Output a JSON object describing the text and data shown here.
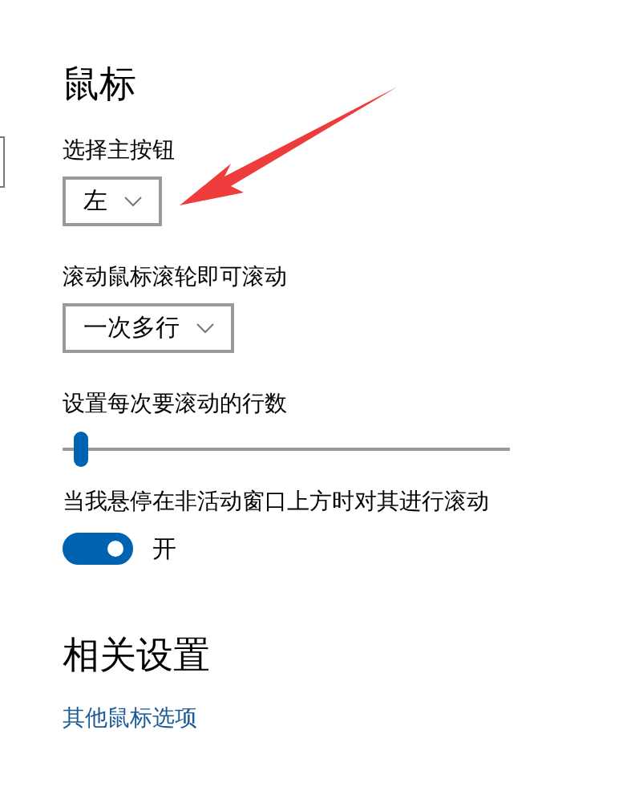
{
  "title": "鼠标",
  "settings": [
    {
      "kind": "dropdown",
      "label": "选择主按钮",
      "value": "左"
    },
    {
      "kind": "dropdown",
      "label": "滚动鼠标滚轮即可滚动",
      "value": "一次多行"
    },
    {
      "kind": "slider",
      "label": "设置每次要滚动的行数",
      "level": 0.02
    },
    {
      "kind": "toggle",
      "label": "当我悬停在非活动窗口上方时对其进行滚动",
      "on": true,
      "state_text": "开"
    }
  ],
  "related": {
    "title": "相关设置",
    "links": [
      "其他鼠标选项"
    ]
  }
}
